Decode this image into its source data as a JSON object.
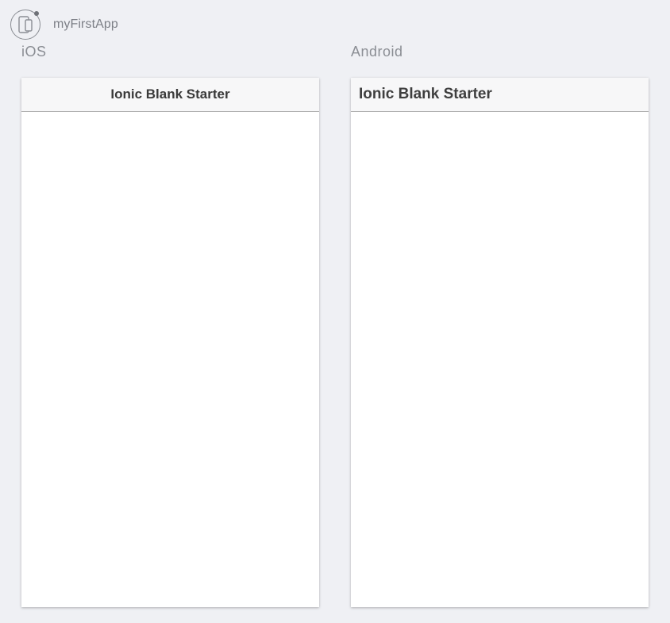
{
  "app": {
    "name": "myFirstApp",
    "logo_icon": "ionic-devices-icon"
  },
  "platforms": {
    "ios": {
      "label": "iOS",
      "title": "Ionic Blank Starter"
    },
    "android": {
      "label": "Android",
      "title": "Ionic Blank Starter"
    }
  },
  "colors": {
    "background": "#eff0f4",
    "header_bg": "#f7f7f8",
    "header_border": "#b2b2b2"
  }
}
